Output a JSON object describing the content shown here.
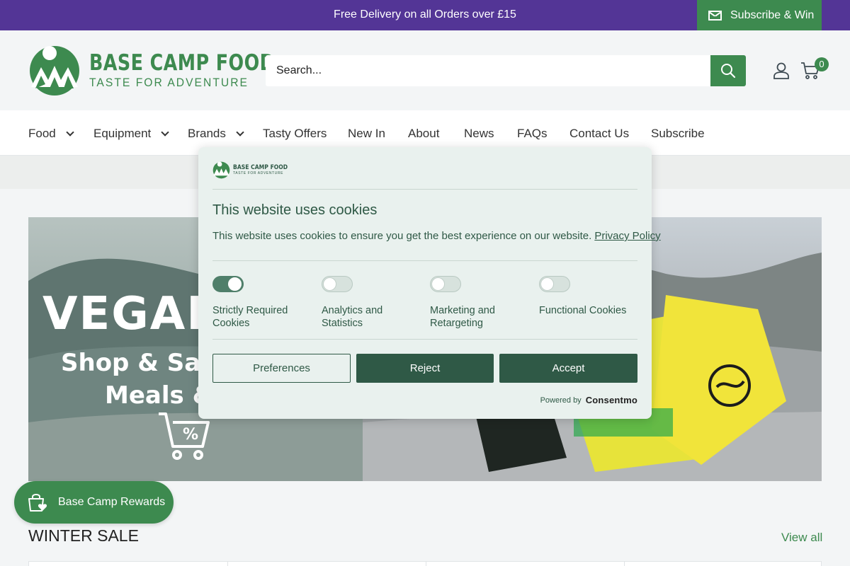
{
  "announcement": {
    "text": "Free Delivery on all Orders over £15",
    "subscribe_label": "Subscribe & Win"
  },
  "header": {
    "logo_title": "BASE CAMP FOOD",
    "logo_tagline": "TASTE FOR ADVENTURE",
    "search_placeholder": "Search...",
    "cart_count": "0"
  },
  "nav": {
    "items": [
      {
        "label": "Food",
        "dropdown": true
      },
      {
        "label": "Equipment",
        "dropdown": true
      },
      {
        "label": "Brands",
        "dropdown": true
      },
      {
        "label": "Tasty Offers",
        "dropdown": false
      },
      {
        "label": "New In",
        "dropdown": false
      },
      {
        "label": "About",
        "dropdown": false
      },
      {
        "label": "News",
        "dropdown": false
      },
      {
        "label": "FAQs",
        "dropdown": false
      },
      {
        "label": "Contact Us",
        "dropdown": false
      },
      {
        "label": "Subscribe",
        "dropdown": false
      }
    ]
  },
  "hero": {
    "title": "VEGAN",
    "line1": "Shop & Save",
    "line2": "Meals &"
  },
  "cookie_banner": {
    "logo_title": "BASE CAMP FOOD",
    "logo_tagline": "TASTE FOR ADVENTURE",
    "title": "This website uses cookies",
    "description": "This website uses cookies to ensure you get the best experience on our website.",
    "privacy_link": "Privacy Policy",
    "toggles": [
      {
        "label": "Strictly Required Cookies",
        "enabled": true
      },
      {
        "label": "Analytics and Statistics",
        "enabled": false
      },
      {
        "label": "Marketing and Retargeting",
        "enabled": false
      },
      {
        "label": "Functional Cookies",
        "enabled": false
      }
    ],
    "buttons": {
      "preferences": "Preferences",
      "reject": "Reject",
      "accept": "Accept"
    },
    "powered_by": "Powered by",
    "provider": "Consentmo"
  },
  "rewards": {
    "label": "Base Camp Rewards"
  },
  "section": {
    "title": "WINTER SALE",
    "view_all": "View all"
  },
  "colors": {
    "announcement_bg": "#533596",
    "brand_green": "#3d8a4f",
    "cookie_dark": "#2f5946",
    "cookie_bg": "#e9f1ee"
  }
}
